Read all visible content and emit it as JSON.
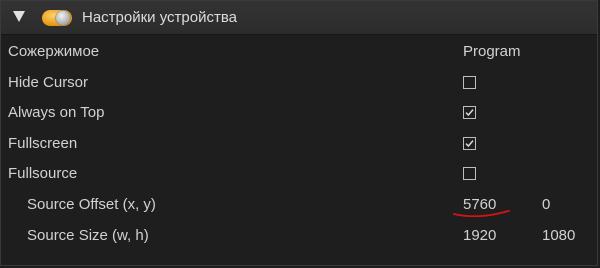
{
  "header": {
    "title": "Настройки устройства"
  },
  "table": {
    "header_label": "Сожержимое",
    "header_value": "Program"
  },
  "rows": [
    {
      "label": "Hide Cursor",
      "checked": false
    },
    {
      "label": "Always on Top",
      "checked": true
    },
    {
      "label": "Fullscreen",
      "checked": true
    },
    {
      "label": "Fullsource",
      "checked": false
    }
  ],
  "source_offset": {
    "label": "Source Offset (x, y)",
    "x": "5760",
    "y": "0"
  },
  "source_size": {
    "label": "Source Size (w, h)",
    "w": "1920",
    "h": "1080"
  },
  "colors": {
    "background": "#1e1e1e",
    "header": "#2e2e2e",
    "text": "#d2d2d2",
    "annotation": "#d21414"
  }
}
